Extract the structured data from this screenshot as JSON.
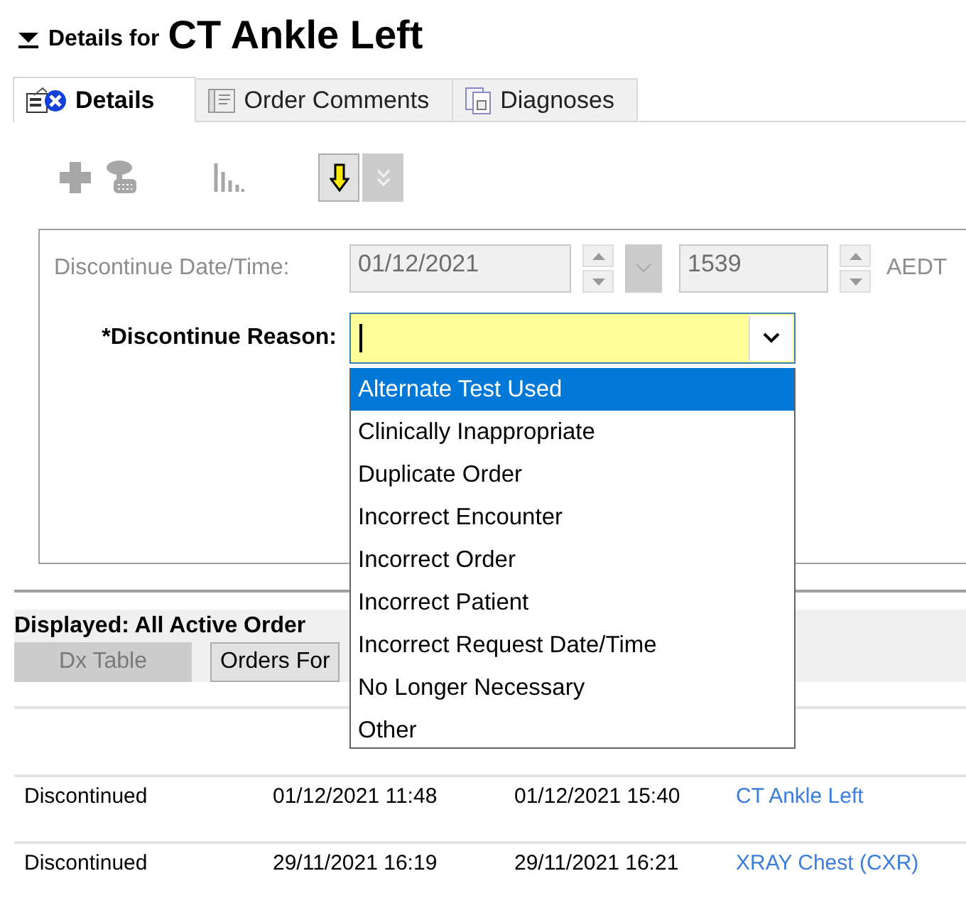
{
  "header": {
    "prefix": "Details for",
    "title": "CT Ankle Left",
    "expanded": true
  },
  "tabs": [
    {
      "label": "Details",
      "kind": "details",
      "selected": true
    },
    {
      "label": "Order Comments",
      "kind": "comments",
      "selected": false
    },
    {
      "label": "Diagnoses",
      "kind": "diagnoses",
      "selected": false
    }
  ],
  "toolbar": [
    {
      "kind": "add",
      "disabled": true
    },
    {
      "kind": "device",
      "disabled": true
    },
    {
      "kind": "chart",
      "disabled": true
    },
    {
      "kind": "move-down",
      "disabled": false
    },
    {
      "kind": "expand",
      "disabled": true
    }
  ],
  "form": {
    "disabled": true,
    "date_label": "Discontinue Date/Time:",
    "date_value": "01/12/2021",
    "time_value": "1539",
    "timezone": "AEDT",
    "reason_label": "*Discontinue Reason:"
  },
  "dropdown": {
    "options": [
      {
        "label": "Alternate Test Used",
        "selected": true
      },
      {
        "label": "Clinically Inappropriate",
        "selected": false
      },
      {
        "label": "Duplicate Order",
        "selected": false
      },
      {
        "label": "Incorrect Encounter",
        "selected": false
      },
      {
        "label": "Incorrect Order",
        "selected": false
      },
      {
        "label": "Incorrect Patient",
        "selected": false
      },
      {
        "label": "Incorrect Request Date/Time",
        "selected": false
      },
      {
        "label": "No Longer Necessary",
        "selected": false
      },
      {
        "label": "Other",
        "selected": false
      }
    ]
  },
  "orders": {
    "displayed_label": "Displayed: All Active Order",
    "buttons": [
      {
        "label": "Dx Table",
        "disabled": true
      },
      {
        "label": "Orders For",
        "disabled": false
      }
    ],
    "rows": [
      {
        "status": "Discontinued",
        "start": "01/12/2021 11:48",
        "stop": "01/12/2021 15:40",
        "name": "CT Ankle Left"
      },
      {
        "status": "Discontinued",
        "start": "29/11/2021 16:19",
        "stop": "29/11/2021 16:21",
        "name": "XRAY Chest (CXR)"
      }
    ]
  }
}
